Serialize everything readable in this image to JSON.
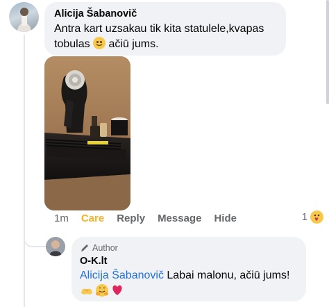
{
  "comment": {
    "author": "Alicija Šabanovič",
    "text_line1": "Antra kart uzsakau tik kita statulele,kvapas",
    "text_line2_before": "tobulas",
    "text_line2_after": "ačiū jums.",
    "emoji": "slightly-smiling-face-icon",
    "photo_alt": "statue-candle-photo"
  },
  "actions": {
    "time": "1m",
    "care": "Care",
    "reply": "Reply",
    "message": "Message",
    "hide": "Hide"
  },
  "reactions": {
    "count": "1",
    "icon": "care-reaction-icon"
  },
  "reply": {
    "badge": "Author",
    "author": "O-K.lt",
    "mention": "Alicija Šabanovič",
    "text": "Labai malonu, ačiū jums!",
    "emojis": [
      "hands-heart-icon",
      "hugging-face-icon",
      "red-heart-icon"
    ]
  },
  "colors": {
    "accent": "#216fdb",
    "care": "#f7b125",
    "bubble_bg": "#f0f2f5"
  }
}
